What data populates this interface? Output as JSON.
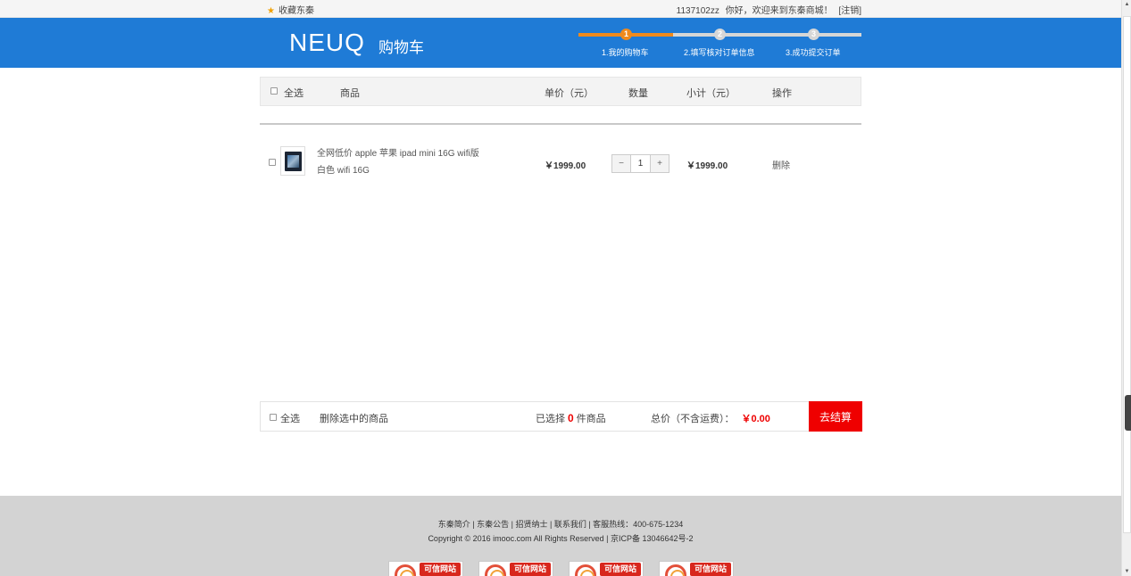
{
  "topbar": {
    "favorite": "收藏东秦",
    "username": "1137102zz",
    "welcome": "你好，欢迎来到东秦商城！",
    "logout": "[注销]"
  },
  "header": {
    "logo": "NEUQ",
    "title": "购物车",
    "steps": [
      {
        "num": "1",
        "label": "1.我的购物车"
      },
      {
        "num": "2",
        "label": "2.填写核对订单信息"
      },
      {
        "num": "3",
        "label": "3.成功提交订单"
      }
    ]
  },
  "cart": {
    "headers": {
      "select_all": "全选",
      "goods": "商品",
      "price": "单价（元）",
      "qty": "数量",
      "subtotal": "小计（元）",
      "op": "操作"
    },
    "items": [
      {
        "name": "全网低价 apple 苹果 ipad mini 16G wifi版",
        "spec": "白色 wifi 16G",
        "price": "￥1999.00",
        "qty": "1",
        "minus": "−",
        "plus": "+",
        "subtotal": "￥1999.00",
        "delete": "删除"
      }
    ]
  },
  "summary": {
    "select_all": "全选",
    "delete_selected": "删除选中的商品",
    "selected_prefix": "已选择",
    "selected_count": "0",
    "selected_suffix": "件商品",
    "total_label": "总价（不含运费）：",
    "total_amount": "￥0.00",
    "checkout": "去结算"
  },
  "footer": {
    "links": "东秦简介 | 东秦公告 | 招贤纳士 | 联系我们 | 客服热线：400-675-1234",
    "copyright": "Copyright © 2016 imooc.com All Rights Reserved | 京ICP备 13046642号-2",
    "badge_text": "可信网站"
  },
  "colors": {
    "header_blue": "#1f7bd6",
    "step_active": "#f08a1c",
    "step_inactive": "#d6d6d6",
    "checkout_red": "#ef0000",
    "footer_gray": "#d3d3d3"
  }
}
